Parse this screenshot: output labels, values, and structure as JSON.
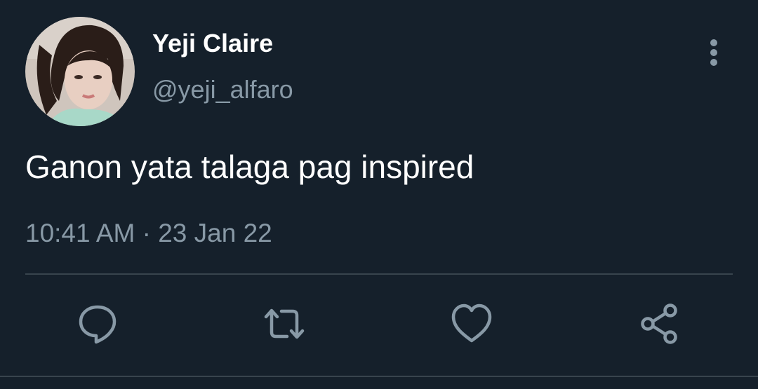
{
  "tweet": {
    "display_name": "Yeji Claire",
    "handle": "@yeji_alfaro",
    "text": "Ganon yata talaga pag inspired",
    "timestamp": "10:41 AM · 23 Jan 22"
  },
  "icons": {
    "more": "more-vertical-icon",
    "reply": "reply-icon",
    "retweet": "retweet-icon",
    "like": "heart-icon",
    "share": "share-icon"
  },
  "colors": {
    "background": "#15202b",
    "primary_text": "#ffffff",
    "secondary_text": "#8899a6",
    "divider": "#38444d"
  }
}
